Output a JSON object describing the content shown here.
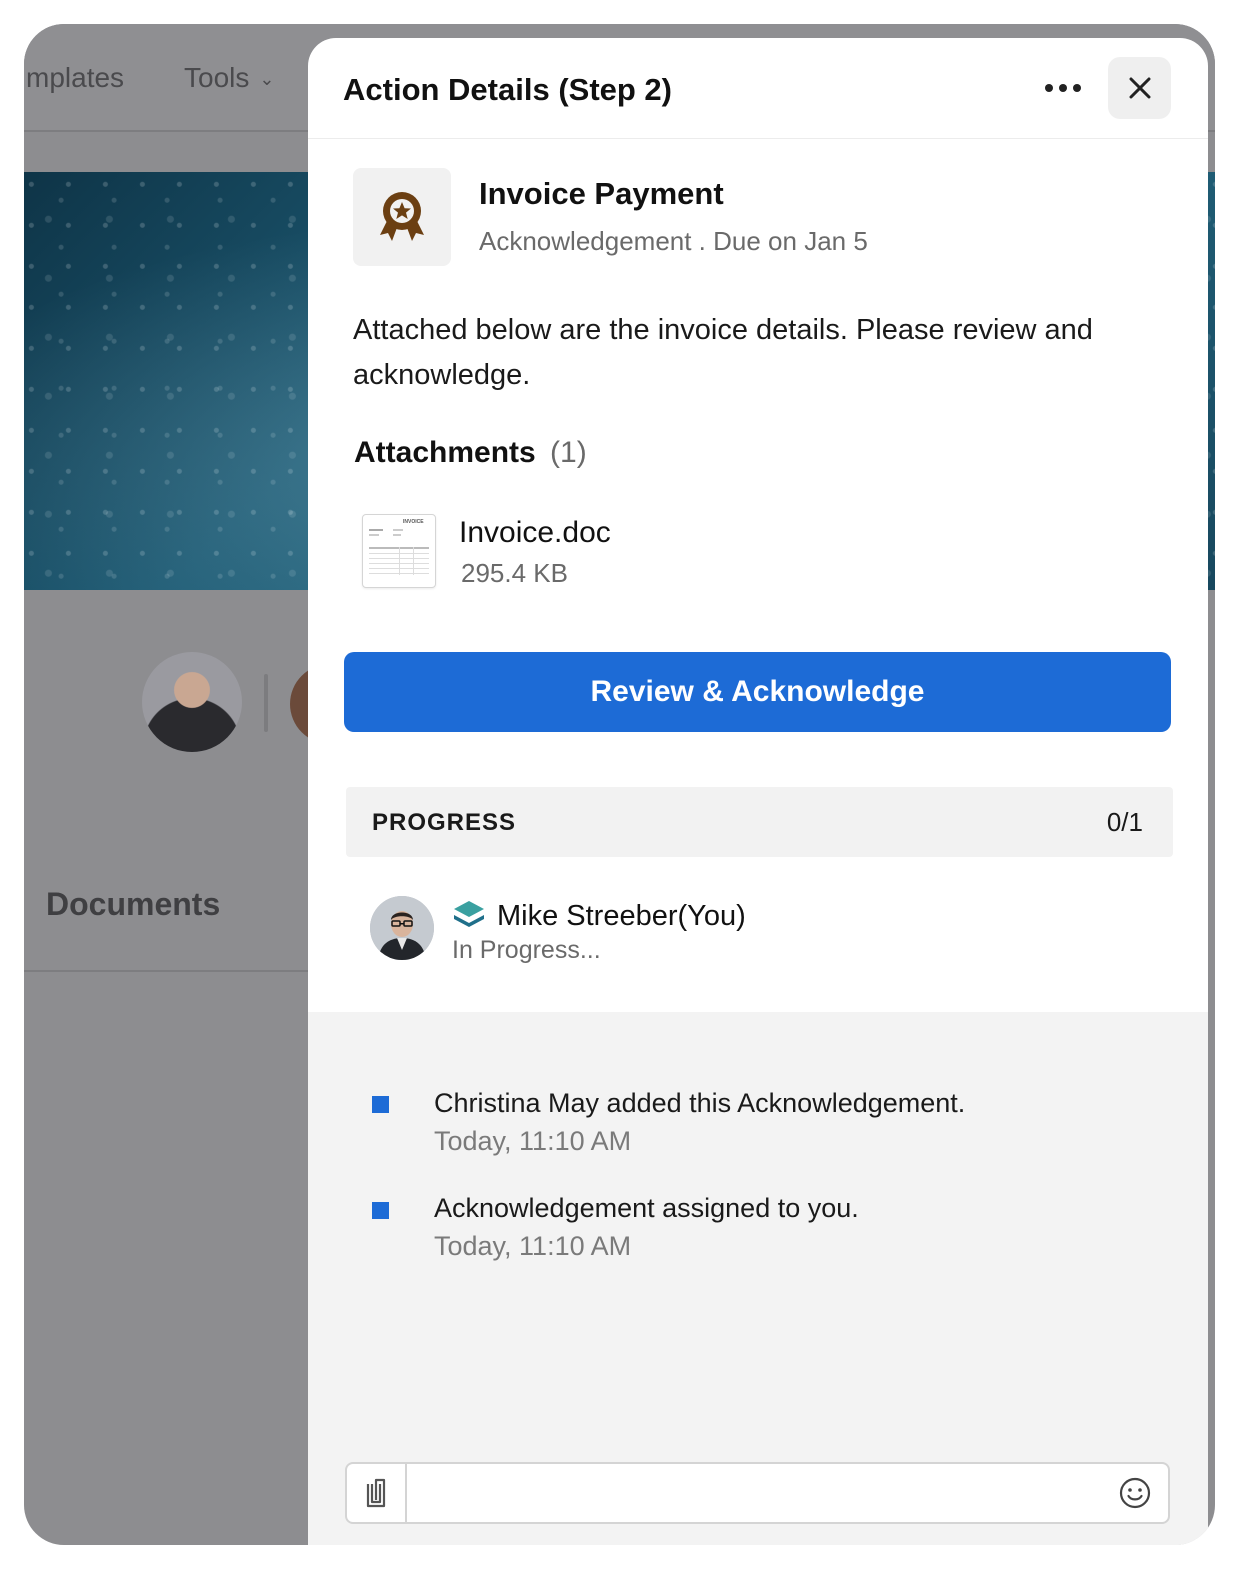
{
  "background": {
    "nav_templates": "mplates",
    "nav_tools": "Tools",
    "documents_heading": "Documents"
  },
  "panel": {
    "title": "Action Details (Step 2)",
    "task": {
      "title": "Invoice Payment",
      "subtitle": "Acknowledgement . Due on Jan 5",
      "icon": "award-ribbon-icon"
    },
    "description": "Attached below are the invoice details. Please review and acknowledge.",
    "attachments": {
      "label": "Attachments",
      "count": "(1)",
      "files": [
        {
          "name": "Invoice.doc",
          "size": "295.4 KB",
          "thumb_label": "INVOICE"
        }
      ]
    },
    "primary_button": "Review & Acknowledge",
    "progress": {
      "label": "PROGRESS",
      "count": "0/1"
    },
    "assignee": {
      "name": "Mike Streeber(You)",
      "status": "In Progress..."
    },
    "activity": [
      {
        "text": "Christina May added this Acknowledgement.",
        "time": "Today, 11:10 AM"
      },
      {
        "text": "Acknowledgement assigned to you.",
        "time": "Today, 11:10 AM"
      }
    ],
    "composer": {
      "placeholder": ""
    }
  },
  "colors": {
    "accent": "#1d6bd6",
    "overlay": "#8d8d90",
    "award_icon": "#6b3f12",
    "stack_icon": "#2b8a8a"
  }
}
